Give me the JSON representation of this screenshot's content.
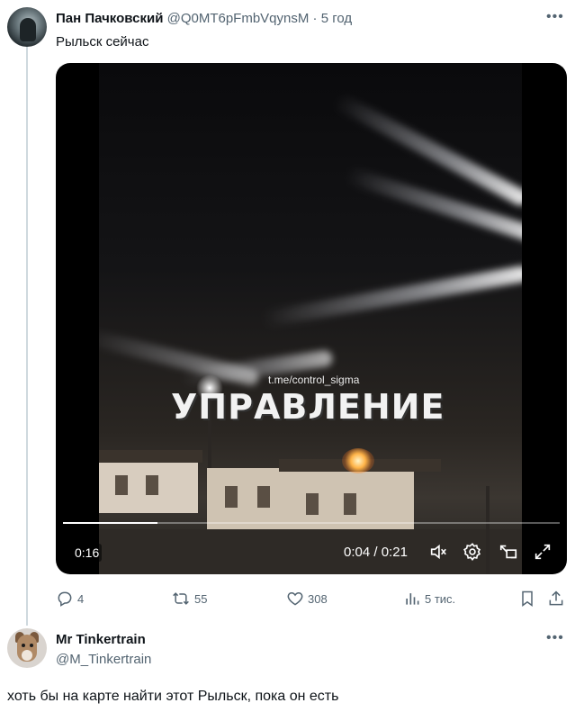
{
  "tweet": {
    "author_name": "Пан Пачковский",
    "handle": "@Q0MT6pFmbVqynsM",
    "separator": " · ",
    "time": "5 год",
    "text": "Рыльск сейчас",
    "more_icon": "more-dots-icon",
    "video": {
      "watermark_link": "t.me/control_sigma",
      "watermark_text": "УПРАВЛЕНИЕ",
      "remaining_label": "0:16",
      "current_time": "0:04",
      "time_separator": " / ",
      "duration": "0:21",
      "progress_fraction": 0.19,
      "icons": [
        "mute-icon",
        "settings-gear-icon",
        "picture-in-picture-icon",
        "fullscreen-icon"
      ]
    },
    "actions": {
      "replies": "4",
      "retweets": "55",
      "likes": "308",
      "views": "5 тис."
    },
    "action_icons": [
      "reply-icon",
      "retweet-icon",
      "like-icon",
      "views-icon",
      "bookmark-icon",
      "share-icon"
    ]
  },
  "reply": {
    "author_name": "Mr Tinkertrain",
    "handle": "@M_Tinkertrain",
    "text": "хоть бы на карте найти этот Рыльск, пока он  есть"
  },
  "colors": {
    "text_primary": "#0f1419",
    "text_secondary": "#536471",
    "thread_line": "#cfd9de",
    "media_bg": "#000000"
  }
}
